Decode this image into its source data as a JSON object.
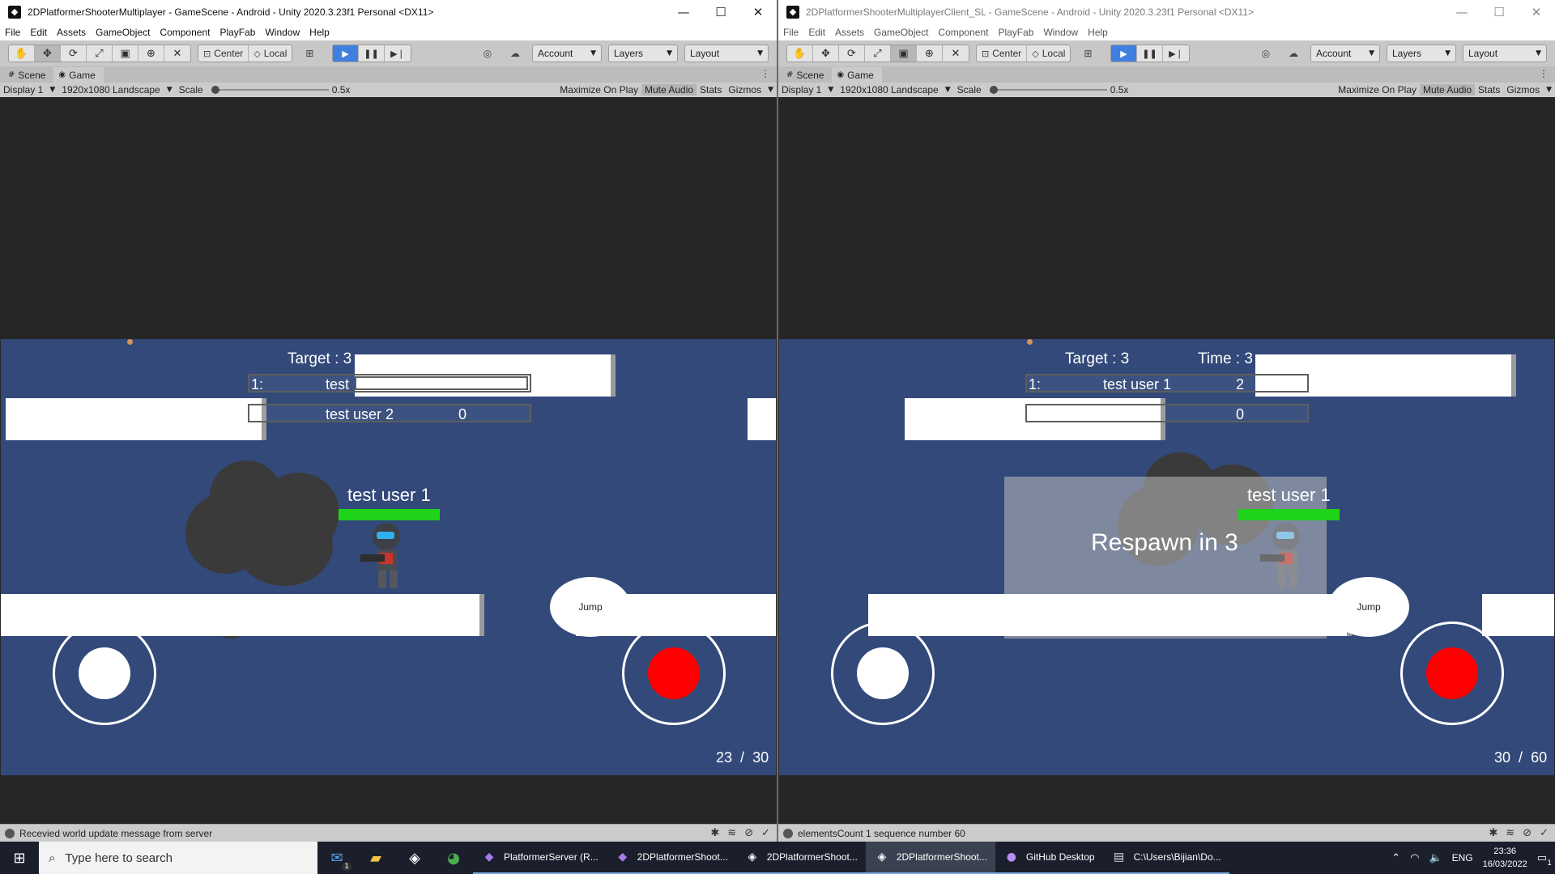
{
  "left_window": {
    "title": "2DPlatformerShooterMultiplayer - GameScene - Android - Unity 2020.3.23f1 Personal <DX11>",
    "status": "Recevied world update message from server",
    "hud": {
      "target": "Target : 3",
      "row1_rank": "1:",
      "row1_name": "test",
      "row2_name": "test user 2",
      "row2_score": "0"
    },
    "player_name": "test user 1",
    "jump": "Jump",
    "counter_a": "23",
    "counter_sep": "/",
    "counter_b": "30"
  },
  "right_window": {
    "title": "2DPlatformerShooterMultiplayerClient_SL - GameScene - Android - Unity 2020.3.23f1 Personal <DX11>",
    "status": "elementsCount 1 sequence number 60",
    "hud": {
      "target": "Target : 3",
      "time": "Time : 3",
      "row1_rank": "1:",
      "row1_name": "test user 1",
      "row1_score": "2",
      "row2_score": "0"
    },
    "player_name": "test user 1",
    "respawn": "Respawn in 3",
    "jump": "Jump",
    "counter_a": "30",
    "counter_sep": "/",
    "counter_b": "60"
  },
  "menu": [
    "File",
    "Edit",
    "Assets",
    "GameObject",
    "Component",
    "PlayFab",
    "Window",
    "Help"
  ],
  "toolbar": {
    "center": "Center",
    "local": "Local",
    "account": "Account",
    "layers": "Layers",
    "layout": "Layout"
  },
  "tabs": {
    "scene": "Scene",
    "game": "Game"
  },
  "gamebar": {
    "display": "Display 1",
    "resolution": "1920x1080 Landscape",
    "scale_label": "Scale",
    "scale_value": "0.5x",
    "maximize": "Maximize On Play",
    "mute": "Mute Audio",
    "stats": "Stats",
    "gizmos": "Gizmos"
  },
  "window_controls": {
    "minimize": "—",
    "maximize": "☐",
    "close": "✕"
  },
  "taskbar": {
    "search_placeholder": "Type here to search",
    "apps": [
      "PlatformerServer (R...",
      "2DPlatformerShoot...",
      "2DPlatformerShoot...",
      "2DPlatformerShoot...",
      "GitHub Desktop",
      "C:\\Users\\Bijian\\Do..."
    ],
    "language": "ENG",
    "time": "23:36",
    "date": "16/03/2022",
    "mail_badge": "1",
    "notification_badge": "1"
  },
  "colors": {
    "game_bg": "#32497a",
    "health": "#1fd31a",
    "fire": "#ff0000",
    "play_active": "#3f7fe0"
  },
  "icons": {
    "start": "windows-logo-icon",
    "search": "search-icon",
    "play": "play-icon",
    "pause": "pause-icon",
    "step": "step-icon"
  }
}
